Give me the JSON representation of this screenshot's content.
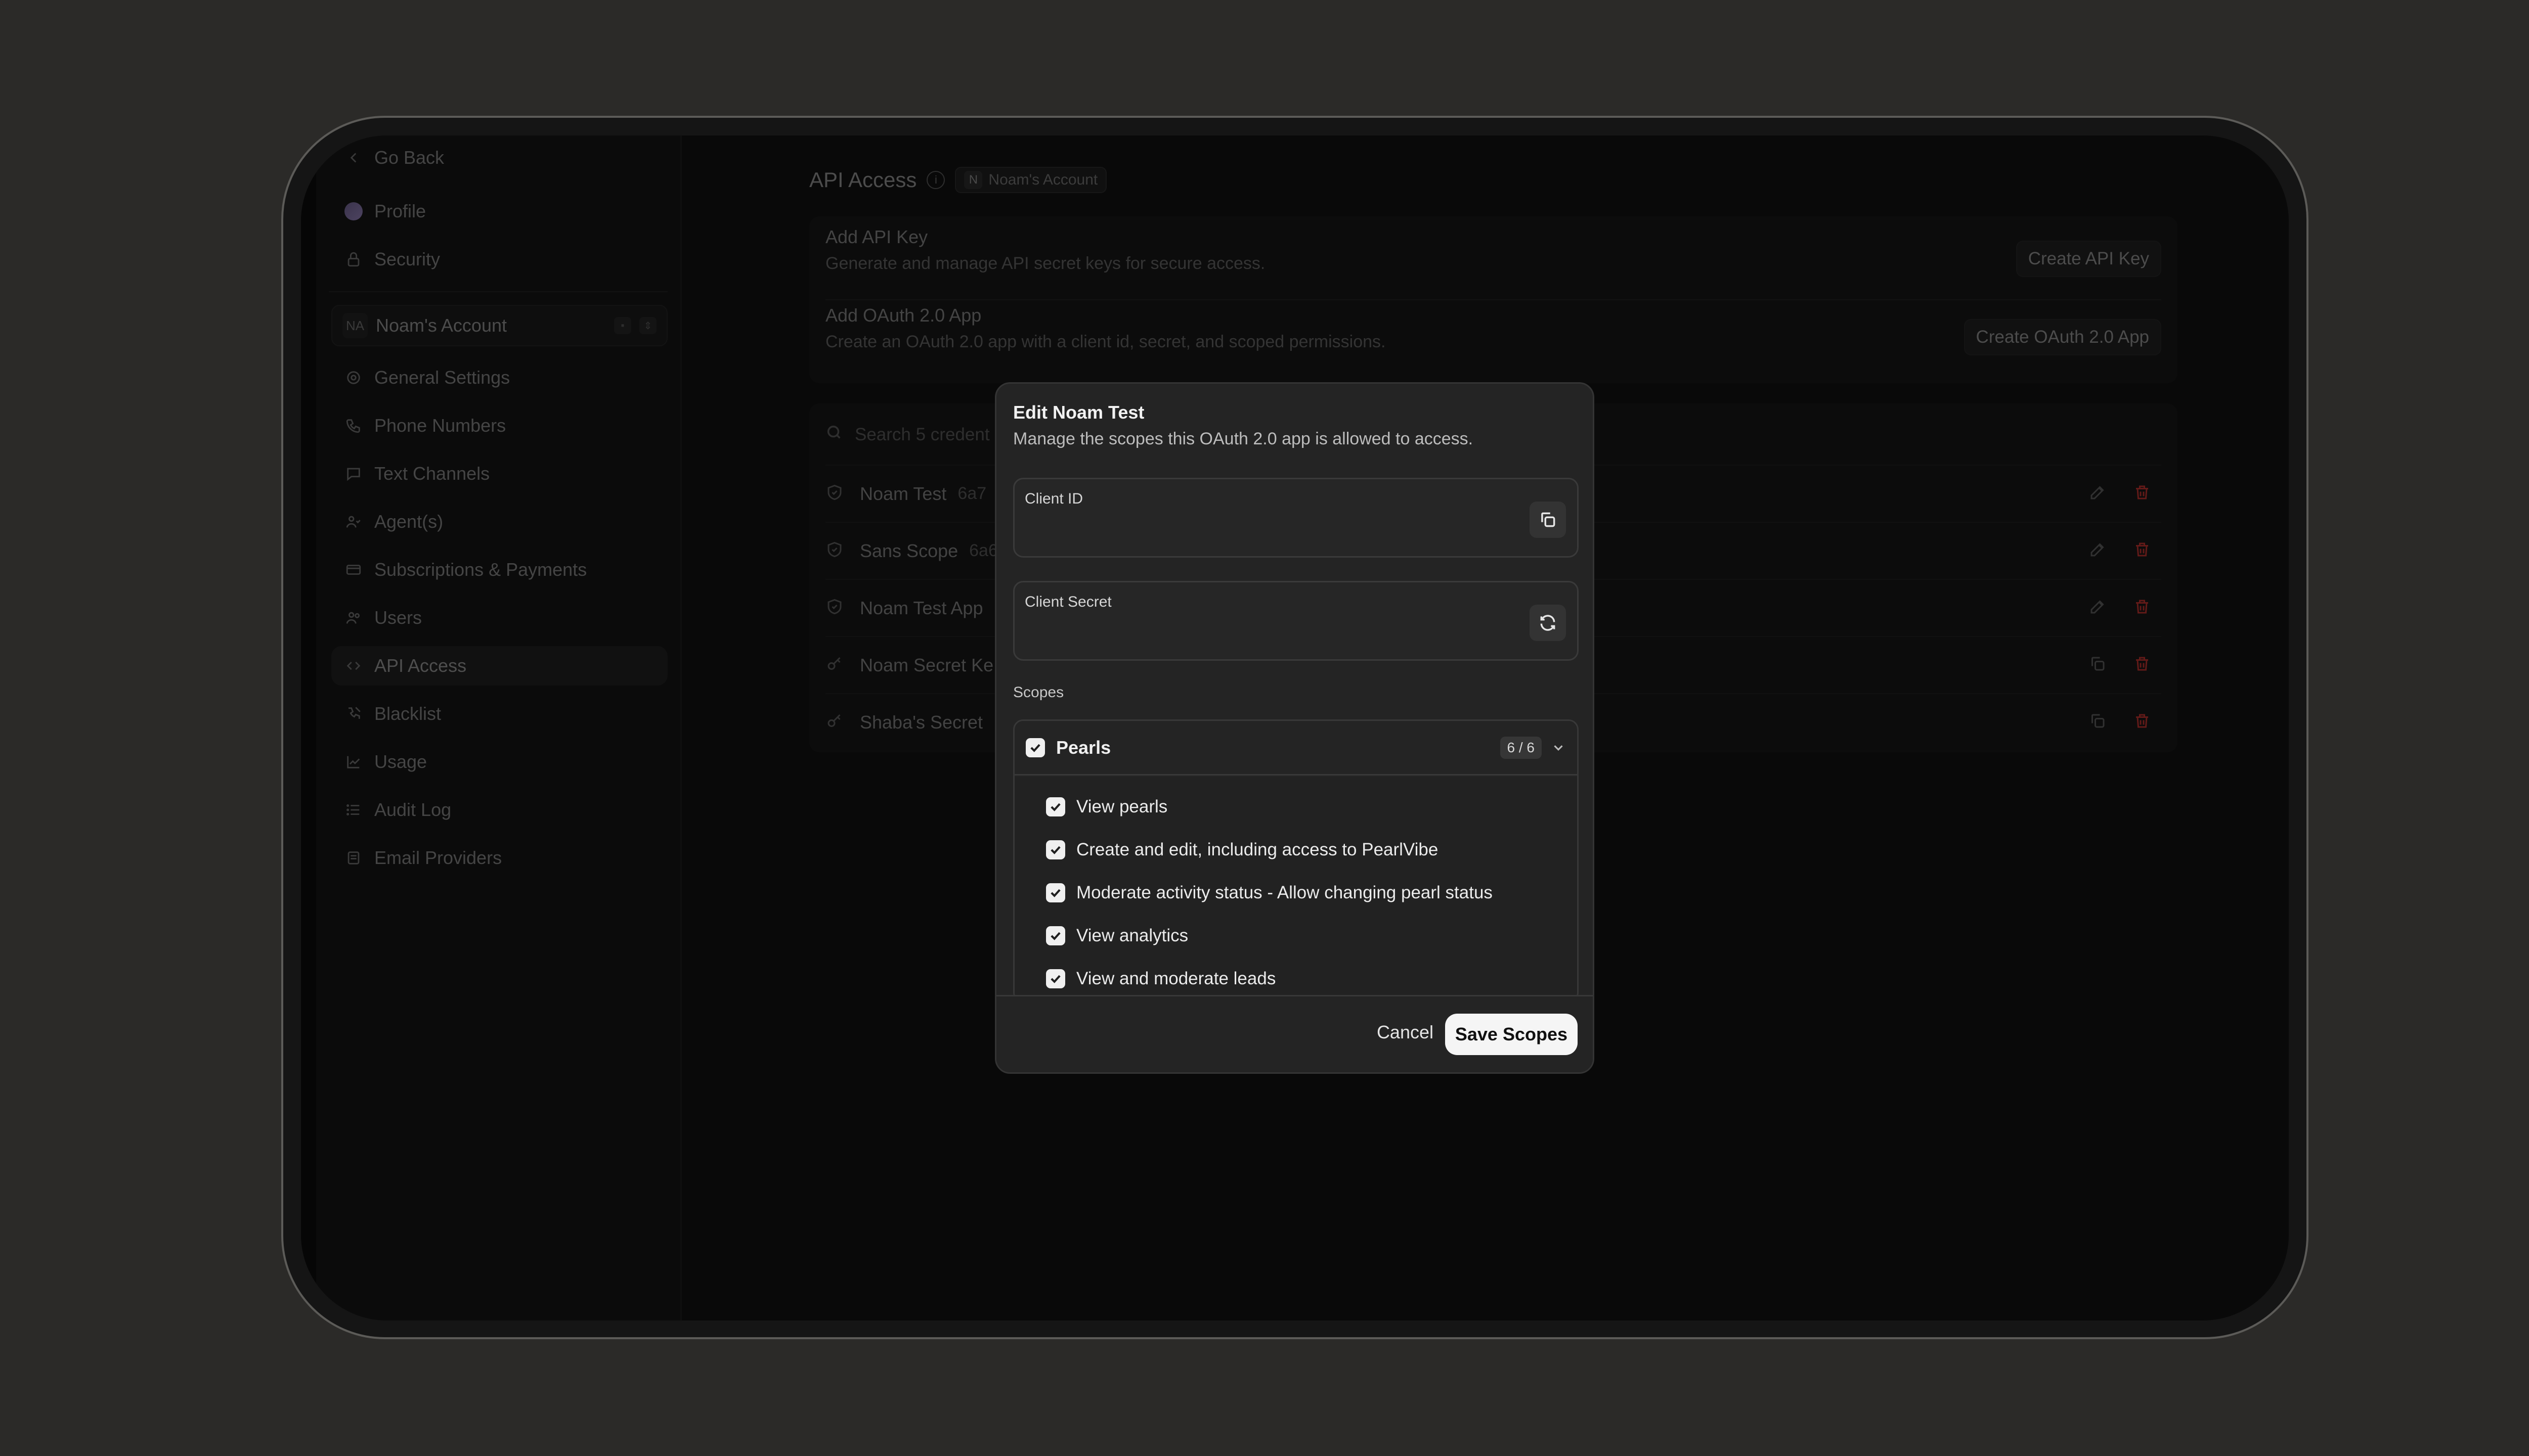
{
  "sidebar": {
    "go_back": "Go Back",
    "profile": "Profile",
    "security": "Security",
    "account": {
      "initials": "NA",
      "name": "Noam's Account"
    },
    "items": [
      {
        "label": "General Settings",
        "icon": "gear-icon"
      },
      {
        "label": "Phone Numbers",
        "icon": "phone-icon"
      },
      {
        "label": "Text Channels",
        "icon": "chat-icon"
      },
      {
        "label": "Agent(s)",
        "icon": "agents-icon"
      },
      {
        "label": "Subscriptions & Payments",
        "icon": "card-icon"
      },
      {
        "label": "Users",
        "icon": "users-icon"
      },
      {
        "label": "API Access",
        "icon": "code-icon"
      },
      {
        "label": "Blacklist",
        "icon": "phone-block-icon"
      },
      {
        "label": "Usage",
        "icon": "chart-icon"
      },
      {
        "label": "Audit Log",
        "icon": "list-icon"
      },
      {
        "label": "Email Providers",
        "icon": "mail-icon"
      }
    ]
  },
  "header": {
    "title": "API Access",
    "account_initial": "N",
    "account_name": "Noam's Account"
  },
  "actions": {
    "api_key": {
      "title": "Add API Key",
      "desc": "Generate and manage API secret keys for secure access.",
      "button": "Create API Key"
    },
    "oauth": {
      "title": "Add OAuth 2.0 App",
      "desc": "Create an OAuth 2.0 app with a client id, secret, and scoped permissions.",
      "button": "Create OAuth 2.0 App"
    }
  },
  "credentials": {
    "search_placeholder": "Search 5 credent",
    "rows": [
      {
        "name": "Noam Test",
        "id": "6a7",
        "type": "oauth"
      },
      {
        "name": "Sans Scope",
        "id": "6a6",
        "type": "oauth"
      },
      {
        "name": "Noam Test App",
        "id": "",
        "type": "oauth"
      },
      {
        "name": "Noam Secret Ke",
        "id": "",
        "type": "key"
      },
      {
        "name": "Shaba's Secret",
        "id": "",
        "type": "key"
      }
    ]
  },
  "modal": {
    "title": "Edit Noam Test",
    "description": "Manage the scopes this OAuth 2.0 app is allowed to access.",
    "client_id_label": "Client ID",
    "client_secret_label": "Client Secret",
    "scopes_label": "Scopes",
    "group": {
      "name": "Pearls",
      "count": "6 / 6"
    },
    "scope_items": [
      "View pearls",
      "Create and edit, including access to PearlVibe",
      "Moderate activity status - Allow changing pearl status",
      "View analytics",
      "View and moderate leads"
    ],
    "cancel": "Cancel",
    "save": "Save Scopes"
  },
  "colors": {
    "danger": "#b3312c",
    "background": "#2b2a28",
    "primary_button": "#f5f5f5"
  }
}
